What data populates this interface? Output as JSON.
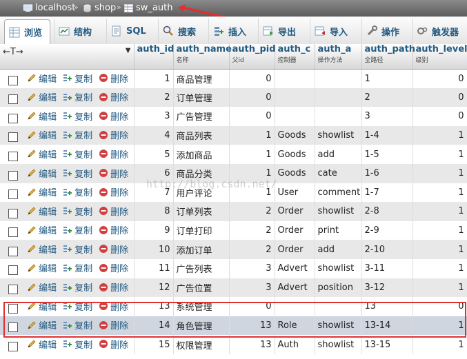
{
  "breadcrumb": {
    "server": "localhost",
    "database": "shop",
    "table": "sw_auth",
    "sep": "»"
  },
  "tabs": [
    {
      "label": "浏览",
      "icon": "browse-icon"
    },
    {
      "label": "结构",
      "icon": "structure-icon"
    },
    {
      "label": "SQL",
      "icon": "sql-icon"
    },
    {
      "label": "搜索",
      "icon": "search-icon"
    },
    {
      "label": "插入",
      "icon": "insert-icon"
    },
    {
      "label": "导出",
      "icon": "export-icon"
    },
    {
      "label": "导入",
      "icon": "import-icon"
    },
    {
      "label": "操作",
      "icon": "operations-icon"
    },
    {
      "label": "触发器",
      "icon": "triggers-icon"
    }
  ],
  "columns": {
    "control": "←T→",
    "auth_id": {
      "name": "auth_id",
      "comment": ""
    },
    "auth_name": {
      "name": "auth_name",
      "comment": "名称"
    },
    "auth_pid": {
      "name": "auth_pid",
      "comment": "父id"
    },
    "auth_c": {
      "name": "auth_c",
      "comment": "控制器"
    },
    "auth_a": {
      "name": "auth_a",
      "comment": "操作方法"
    },
    "auth_path": {
      "name": "auth_path",
      "comment": "全路径"
    },
    "auth_level": {
      "name": "auth_level",
      "comment": "级别"
    }
  },
  "actions": {
    "edit": "编辑",
    "copy": "复制",
    "delete": "删除"
  },
  "rows": [
    {
      "id": "1",
      "name": "商品管理",
      "pid": "0",
      "c": "",
      "a": "",
      "path": "1",
      "level": "0"
    },
    {
      "id": "2",
      "name": "订单管理",
      "pid": "0",
      "c": "",
      "a": "",
      "path": "2",
      "level": "0"
    },
    {
      "id": "3",
      "name": "广告管理",
      "pid": "0",
      "c": "",
      "a": "",
      "path": "3",
      "level": "0"
    },
    {
      "id": "4",
      "name": "商品列表",
      "pid": "1",
      "c": "Goods",
      "a": "showlist",
      "path": "1-4",
      "level": "1"
    },
    {
      "id": "5",
      "name": "添加商品",
      "pid": "1",
      "c": "Goods",
      "a": "add",
      "path": "1-5",
      "level": "1"
    },
    {
      "id": "6",
      "name": "商品分类",
      "pid": "1",
      "c": "Goods",
      "a": "cate",
      "path": "1-6",
      "level": "1"
    },
    {
      "id": "7",
      "name": "用户评论",
      "pid": "1",
      "c": "User",
      "a": "comment",
      "path": "1-7",
      "level": "1"
    },
    {
      "id": "8",
      "name": "订单列表",
      "pid": "2",
      "c": "Order",
      "a": "showlist",
      "path": "2-8",
      "level": "1"
    },
    {
      "id": "9",
      "name": "订单打印",
      "pid": "2",
      "c": "Order",
      "a": "print",
      "path": "2-9",
      "level": "1"
    },
    {
      "id": "10",
      "name": "添加订单",
      "pid": "2",
      "c": "Order",
      "a": "add",
      "path": "2-10",
      "level": "1"
    },
    {
      "id": "11",
      "name": "广告列表",
      "pid": "3",
      "c": "Advert",
      "a": "showlist",
      "path": "3-11",
      "level": "1"
    },
    {
      "id": "12",
      "name": "广告位置",
      "pid": "3",
      "c": "Advert",
      "a": "position",
      "path": "3-12",
      "level": "1"
    },
    {
      "id": "13",
      "name": "系统管理",
      "pid": "0",
      "c": "",
      "a": "",
      "path": "13",
      "level": "0"
    },
    {
      "id": "14",
      "name": "角色管理",
      "pid": "13",
      "c": "Role",
      "a": "showlist",
      "path": "13-14",
      "level": "1"
    },
    {
      "id": "15",
      "name": "权限管理",
      "pid": "13",
      "c": "Auth",
      "a": "showlist",
      "path": "13-15",
      "level": "1"
    }
  ],
  "watermark": "http://blog.csdn.net/",
  "colors": {
    "link": "#235a81",
    "highlight": "#e03030",
    "selected_row": "#cfd6df",
    "even_row": "#e8e8e8"
  }
}
